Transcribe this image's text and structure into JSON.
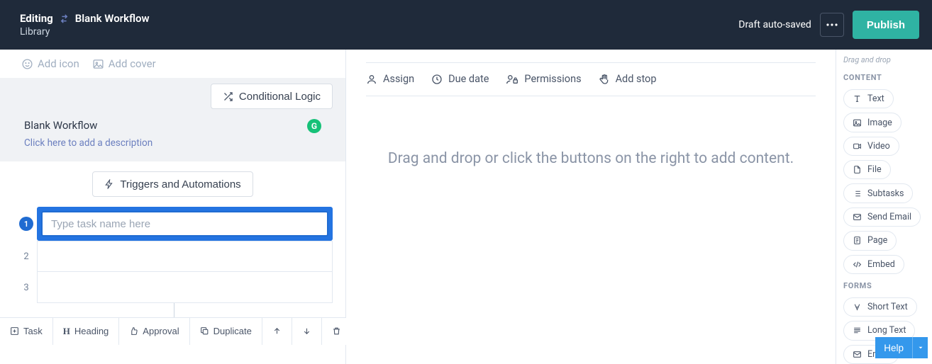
{
  "header": {
    "editing": "Editing",
    "workflow_name": "Blank Workflow",
    "subtitle": "Library",
    "autosave": "Draft auto-saved",
    "publish": "Publish"
  },
  "left": {
    "add_icon": "Add icon",
    "add_cover": "Add cover",
    "conditional_logic": "Conditional Logic",
    "workflow_title": "Blank Workflow",
    "workflow_desc_placeholder": "Click here to add a description",
    "triggers": "Triggers and Automations",
    "tasks": [
      {
        "num": "1",
        "placeholder": "Type task name here",
        "active": true
      },
      {
        "num": "2",
        "placeholder": "",
        "active": false
      },
      {
        "num": "3",
        "placeholder": "",
        "active": false
      }
    ],
    "actions": {
      "task": "Task",
      "heading": "Heading",
      "approval": "Approval",
      "duplicate": "Duplicate"
    }
  },
  "center": {
    "assign": "Assign",
    "due_date": "Due date",
    "permissions": "Permissions",
    "add_stop": "Add stop",
    "placeholder": "Drag and drop or click the buttons on the right to add content."
  },
  "right": {
    "hint": "Drag and drop",
    "content_head": "CONTENT",
    "forms_head": "FORMS",
    "content": [
      {
        "label": "Text"
      },
      {
        "label": "Image"
      },
      {
        "label": "Video"
      },
      {
        "label": "File"
      },
      {
        "label": "Subtasks"
      },
      {
        "label": "Send Email"
      },
      {
        "label": "Page"
      },
      {
        "label": "Embed"
      }
    ],
    "forms": [
      {
        "label": "Short Text"
      },
      {
        "label": "Long Text"
      },
      {
        "label": "Email"
      }
    ]
  },
  "help": {
    "label": "Help"
  }
}
